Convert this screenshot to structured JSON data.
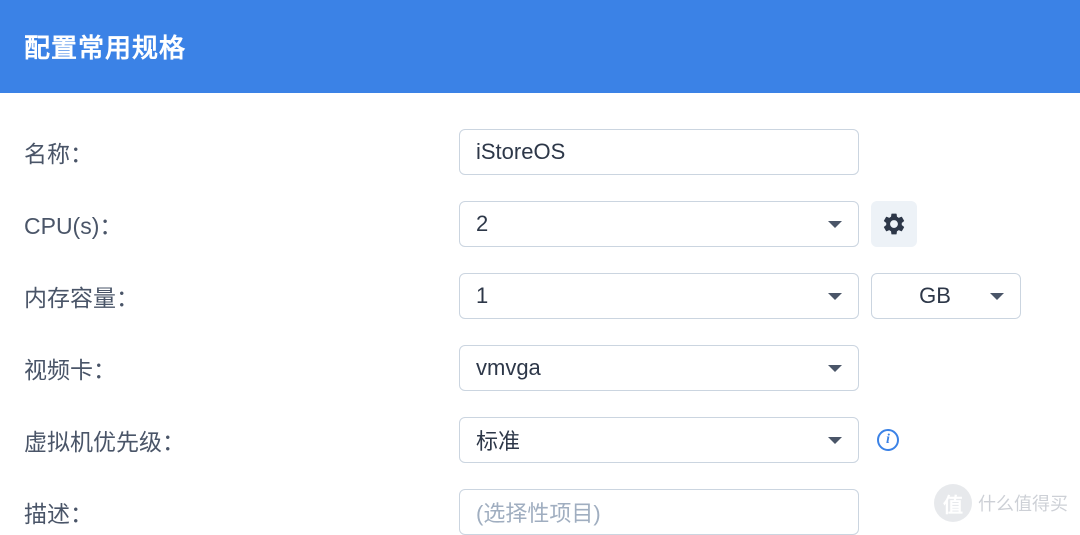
{
  "header": {
    "title": "配置常用规格"
  },
  "form": {
    "name": {
      "label": "名称：",
      "value": "iStoreOS"
    },
    "cpu": {
      "label": "CPU(s)：",
      "value": "2"
    },
    "memory": {
      "label": "内存容量：",
      "value": "1",
      "unit": "GB"
    },
    "video": {
      "label": "视频卡：",
      "value": "vmvga"
    },
    "priority": {
      "label": "虚拟机优先级：",
      "value": "标准"
    },
    "description": {
      "label": "描述：",
      "placeholder": "(选择性项目)"
    }
  },
  "watermark": {
    "badge": "值",
    "text": "什么值得买"
  }
}
